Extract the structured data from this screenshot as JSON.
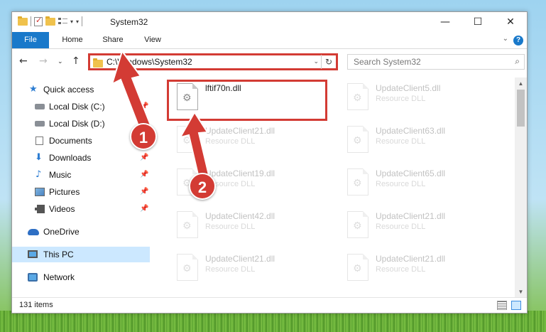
{
  "window": {
    "title": "System32",
    "controls": {
      "minimize": "—",
      "maximize": "☐",
      "close": "✕"
    }
  },
  "ribbon": {
    "tabs": [
      "File",
      "Home",
      "Share",
      "View"
    ],
    "help": "?"
  },
  "address": {
    "path": "C:\\Windows\\System32",
    "search_placeholder": "Search System32"
  },
  "sidebar": {
    "items": [
      {
        "label": "Quick access",
        "icon": "star-icon",
        "pinned": false
      },
      {
        "label": "Local Disk (C:)",
        "icon": "disk-icon",
        "pinned": true
      },
      {
        "label": "Local Disk (D:)",
        "icon": "disk-icon",
        "pinned": false
      },
      {
        "label": "Documents",
        "icon": "documents-icon",
        "pinned": true
      },
      {
        "label": "Downloads",
        "icon": "download-icon",
        "pinned": true
      },
      {
        "label": "Music",
        "icon": "music-icon",
        "pinned": true
      },
      {
        "label": "Pictures",
        "icon": "pictures-icon",
        "pinned": true
      },
      {
        "label": "Videos",
        "icon": "videos-icon",
        "pinned": true
      },
      {
        "label": "OneDrive",
        "icon": "onedrive-icon",
        "pinned": false
      },
      {
        "label": "This PC",
        "icon": "this-pc-icon",
        "pinned": false,
        "selected": true
      },
      {
        "label": "Network",
        "icon": "network-icon",
        "pinned": false
      }
    ]
  },
  "files": [
    {
      "name": "lftif70n.dll",
      "type": "",
      "highlighted": true
    },
    {
      "name": "UpdateClient5.dll",
      "type": "Resource DLL"
    },
    {
      "name": "UpdateClient21.dll",
      "type": "Resource DLL"
    },
    {
      "name": "UpdateClient63.dll",
      "type": "Resource DLL"
    },
    {
      "name": "UpdateClient19.dll",
      "type": "Resource DLL"
    },
    {
      "name": "UpdateClient65.dll",
      "type": "Resource DLL"
    },
    {
      "name": "UpdateClient42.dll",
      "type": "Resource DLL"
    },
    {
      "name": "UpdateClient21.dll",
      "type": "Resource DLL"
    },
    {
      "name": "UpdateClient21.dll",
      "type": "Resource DLL"
    },
    {
      "name": "UpdateClient21.dll",
      "type": "Resource DLL"
    }
  ],
  "status": {
    "item_count": "131 items"
  },
  "annotations": {
    "step1": "1",
    "step2": "2",
    "color": "#d33b34"
  }
}
